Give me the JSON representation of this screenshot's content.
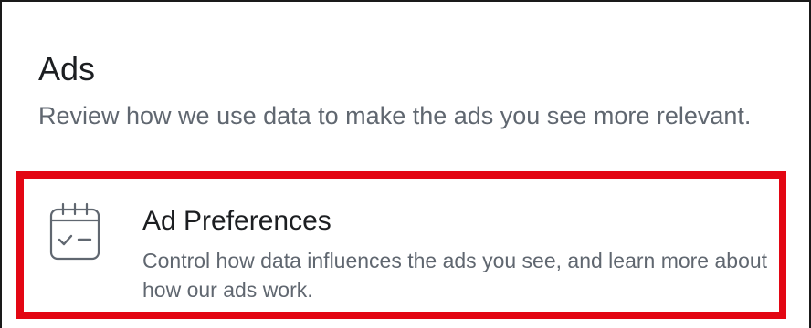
{
  "section": {
    "title": "Ads",
    "description": "Review how we use data to make the ads you see more relevant."
  },
  "ad_preferences": {
    "title": "Ad Preferences",
    "description": "Control how data influences the ads you see, and learn more about how our ads work.",
    "icon": "calendar-check-icon"
  },
  "colors": {
    "highlight": "#e30613",
    "title_text": "#1c1e21",
    "secondary_text": "#606770",
    "icon_stroke": "#606770"
  }
}
